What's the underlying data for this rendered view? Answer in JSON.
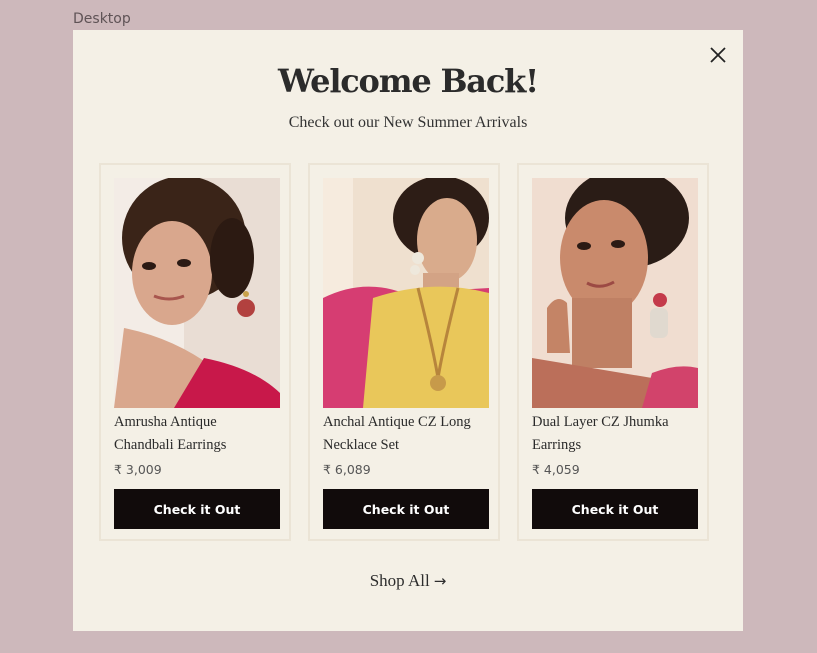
{
  "frame": {
    "label": "Desktop"
  },
  "modal": {
    "title": "Welcome Back!",
    "subtitle": "Check out our New Summer Arrivals",
    "close_icon": "close-icon",
    "shop_all": {
      "label": "Shop All",
      "arrow": "→"
    }
  },
  "products": [
    {
      "name": "Amrusha Antique Chandbali Earrings",
      "price": "₹ 3,009",
      "cta": "Check it Out",
      "image": "model-wearing-chandbali-earrings"
    },
    {
      "name": "Anchal Antique CZ Long Necklace Set",
      "price": "₹ 6,089",
      "cta": "Check it Out",
      "image": "model-wearing-long-necklace"
    },
    {
      "name": "Dual Layer CZ Jhumka Earrings",
      "price": "₹ 4,059",
      "cta": "Check it Out",
      "image": "model-wearing-jhumka-earrings"
    }
  ],
  "colors": {
    "backdrop": "#cdb8bb",
    "modal_bg": "#f4f0e6",
    "button_bg": "#110b0b",
    "button_text": "#ffffff"
  }
}
